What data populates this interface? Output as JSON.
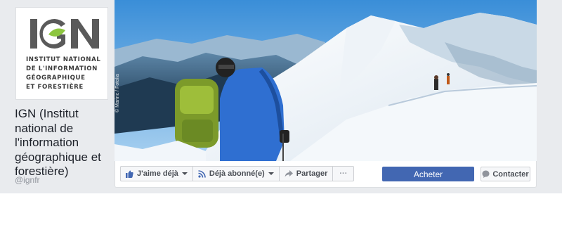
{
  "page": {
    "name": "IGN (Institut national de l'information géographique et forestière)",
    "handle": "@ignfr"
  },
  "logo": {
    "letters": "IGN",
    "text_lines": [
      "INSTITUT NATIONAL",
      "DE L'INFORMATION",
      "GÉOGRAPHIQUE",
      "ET FORESTIÈRE"
    ]
  },
  "cover": {
    "photo_credit": "© Marinc / Fotolia"
  },
  "actions": {
    "like_label": "J'aime déjà",
    "subscribe_label": "Déjà abonné(e)",
    "share_label": "Partager",
    "more_label": "···",
    "buy_label": "Acheter",
    "contact_label": "Contacter"
  },
  "colors": {
    "primary_button": "#4267b2",
    "page_background": "#e9ebee",
    "logo_green": "#8dc63f",
    "logo_gray": "#5a5a5a"
  },
  "icons": {
    "like": "thumbs-up-icon",
    "subscribe": "rss-icon",
    "share": "share-arrow-icon",
    "contact": "message-bubble-icon"
  }
}
